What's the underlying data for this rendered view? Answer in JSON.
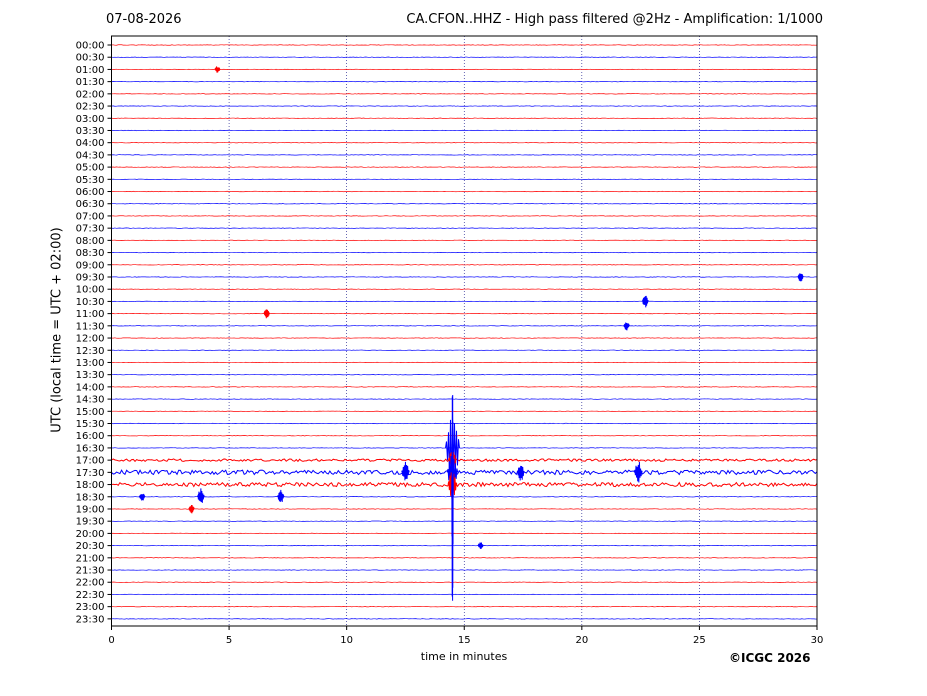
{
  "header": {
    "date": "07-08-2026",
    "title": "CA.CFON..HHZ - High pass filtered @2Hz - Amplification: 1/1000"
  },
  "footer": {
    "copyright": "©ICGC 2026"
  },
  "chart_data": {
    "type": "line",
    "title": "CA.CFON..HHZ - High pass filtered @2Hz - Amplification: 1/1000",
    "xlabel": "time in minutes",
    "ylabel": "UTC (local time = UTC + 02:00)",
    "xlim": [
      0,
      30
    ],
    "x_ticks": [
      "0",
      "5",
      "10",
      "15",
      "20",
      "25",
      "30"
    ],
    "y_ticks": [
      "00:00",
      "00:30",
      "01:00",
      "01:30",
      "02:00",
      "02:30",
      "03:00",
      "03:30",
      "04:00",
      "04:30",
      "05:00",
      "05:30",
      "06:00",
      "06:30",
      "07:00",
      "07:30",
      "08:00",
      "08:30",
      "09:00",
      "09:30",
      "10:00",
      "10:30",
      "11:00",
      "11:30",
      "12:00",
      "12:30",
      "13:00",
      "13:30",
      "14:00",
      "14:30",
      "15:00",
      "15:30",
      "16:00",
      "16:30",
      "17:00",
      "17:30",
      "18:00",
      "18:30",
      "19:00",
      "19:30",
      "20:00",
      "20:30",
      "21:00",
      "21:30",
      "22:00",
      "22:30",
      "23:00",
      "23:30"
    ],
    "grid": "vertical dotted at 5 minute intervals",
    "trace_colors": [
      "#ff0000",
      "#0000ff"
    ],
    "events": [
      {
        "row": "01:00",
        "minute": 4.5,
        "amplitude": 0.3
      },
      {
        "row": "09:30",
        "minute": 29.3,
        "amplitude": 0.4
      },
      {
        "row": "10:30",
        "minute": 22.7,
        "amplitude": 0.5
      },
      {
        "row": "11:00",
        "minute": 6.6,
        "amplitude": 0.4
      },
      {
        "row": "11:30",
        "minute": 21.9,
        "amplitude": 0.4
      },
      {
        "row": "16:30",
        "minute": 14.5,
        "amplitude": 3.5
      },
      {
        "row": "17:00",
        "minute": 14.5,
        "amplitude": 1.0
      },
      {
        "row": "17:30",
        "minute": 14.5,
        "amplitude": 1.6
      },
      {
        "row": "17:30",
        "minute": 22.4,
        "amplitude": 1.0
      },
      {
        "row": "17:30",
        "minute": 12.5,
        "amplitude": 0.9
      },
      {
        "row": "17:30",
        "minute": 17.4,
        "amplitude": 0.8
      },
      {
        "row": "18:00",
        "minute": 14.5,
        "amplitude": 1.2
      },
      {
        "row": "18:30",
        "minute": 14.5,
        "amplitude": 11.0
      },
      {
        "row": "18:30",
        "minute": 3.8,
        "amplitude": 0.7
      },
      {
        "row": "18:30",
        "minute": 7.2,
        "amplitude": 0.6
      },
      {
        "row": "18:30",
        "minute": 1.3,
        "amplitude": 0.4
      },
      {
        "row": "19:00",
        "minute": 3.4,
        "amplitude": 0.4
      },
      {
        "row": "20:30",
        "minute": 15.7,
        "amplitude": 0.3
      }
    ]
  }
}
